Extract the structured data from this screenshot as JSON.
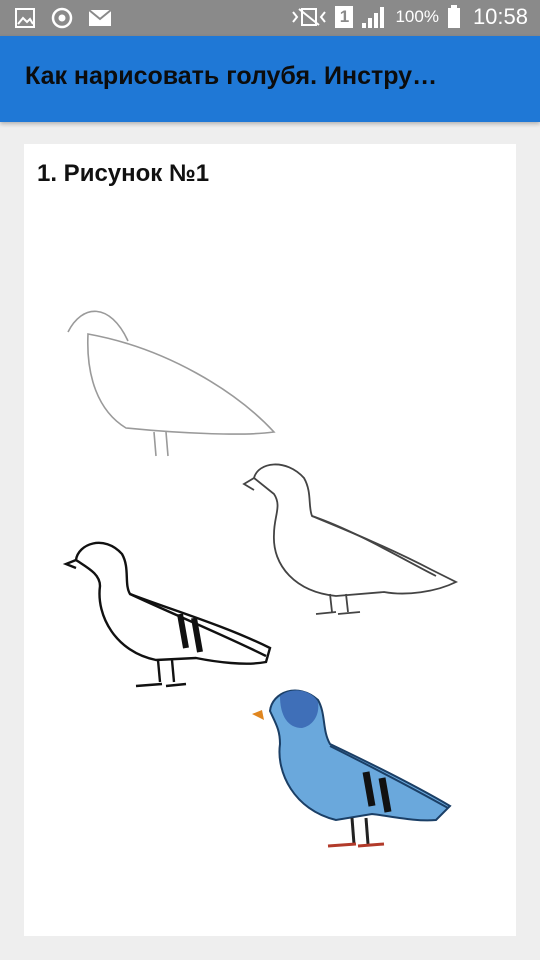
{
  "status_bar": {
    "icons_left": [
      "image-icon",
      "sync-icon",
      "mail-icon"
    ],
    "icons_right": [
      "vibrate-icon",
      "sim-icon",
      "signal-icon",
      "battery-icon"
    ],
    "sim_slot": "1",
    "battery": "100%",
    "time": "10:58"
  },
  "app_bar": {
    "title": "Как нарисовать голубя. Инстру…",
    "color": "#1f78d6"
  },
  "article": {
    "heading": "1. Рисунок №1"
  }
}
